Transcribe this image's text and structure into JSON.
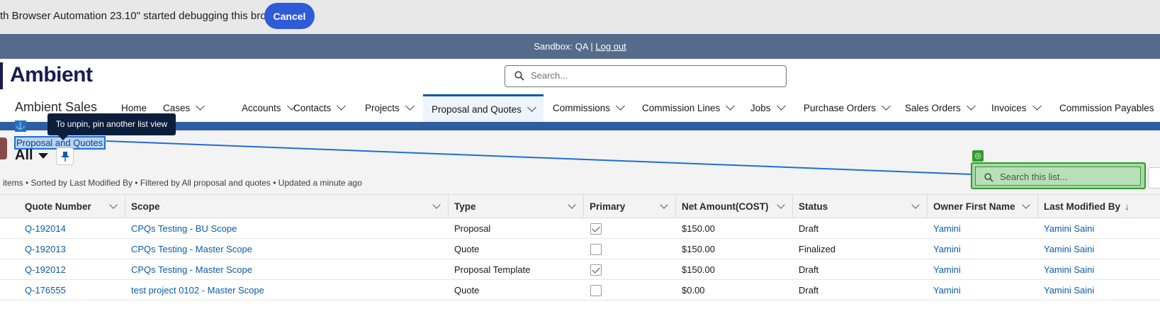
{
  "debug_bar": {
    "text": "th Browser Automation 23.10\" started debugging this browser",
    "cancel_label": "Cancel"
  },
  "sandbox_bar": {
    "text": "Sandbox: QA |",
    "logout_label": "Log out"
  },
  "header": {
    "logo_text": "Ambient",
    "search_placeholder": "Search..."
  },
  "nav": {
    "app_name": "Ambient Sales",
    "items": [
      {
        "label": "Home",
        "dropdown": false
      },
      {
        "label": "Cases",
        "dropdown": true
      },
      {
        "label": "Accounts",
        "dropdown": true
      },
      {
        "label": "Contacts",
        "dropdown": true
      },
      {
        "label": "Projects",
        "dropdown": true
      },
      {
        "label": "Proposal and Quotes",
        "dropdown": true,
        "active": true
      },
      {
        "label": "Commissions",
        "dropdown": true
      },
      {
        "label": "Commission Lines",
        "dropdown": true
      },
      {
        "label": "Jobs",
        "dropdown": true
      },
      {
        "label": "Purchase Orders",
        "dropdown": true
      },
      {
        "label": "Sales Orders",
        "dropdown": true
      },
      {
        "label": "Invoices",
        "dropdown": true
      },
      {
        "label": "Commission Payables",
        "dropdown": true
      }
    ]
  },
  "list_view": {
    "tooltip": "To unpin, pin another list view",
    "object_label": "Proposal and Quotes",
    "view_name": "All",
    "meta": "items • Sorted by Last Modified By • Filtered by All proposal and quotes • Updated a minute ago",
    "search_placeholder": "Search this list..."
  },
  "table": {
    "columns": [
      "Quote Number",
      "Scope",
      "Type",
      "Primary",
      "Net Amount(COST)",
      "Status",
      "Owner First Name",
      "Last Modified By"
    ],
    "sort_arrow": "↓",
    "rows": [
      {
        "quote": "Q-192014",
        "scope": "CPQs Testing - BU Scope",
        "type": "Proposal",
        "primary": true,
        "amount": "$150.00",
        "status": "Draft",
        "owner": "Yamini",
        "modified_by": "Yamini Saini"
      },
      {
        "quote": "Q-192013",
        "scope": "CPQs Testing - Master Scope",
        "type": "Quote",
        "primary": false,
        "amount": "$150.00",
        "status": "Finalized",
        "owner": "Yamini",
        "modified_by": "Yamini Saini"
      },
      {
        "quote": "Q-192012",
        "scope": "CPQs Testing - Master Scope",
        "type": "Proposal Template",
        "primary": true,
        "amount": "$150.00",
        "status": "Draft",
        "owner": "Yamini",
        "modified_by": "Yamini Saini"
      },
      {
        "quote": "Q-176555",
        "scope": "test project 0102 - Master Scope",
        "type": "Quote",
        "primary": false,
        "amount": "$0.00",
        "status": "Draft",
        "owner": "Yamini",
        "modified_by": "Yamini Saini"
      }
    ]
  }
}
